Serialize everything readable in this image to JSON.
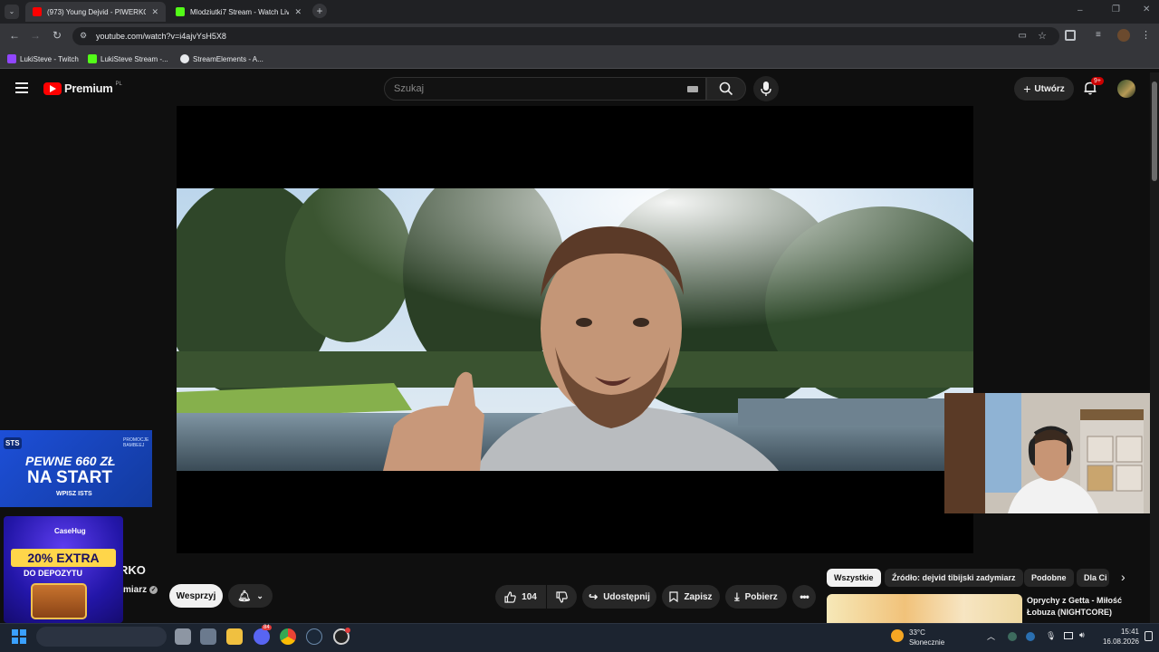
{
  "browser": {
    "tabs": [
      {
        "title": "(973) Young Dejvid - PIWERKO",
        "active": true
      },
      {
        "title": "Mlodziutki7 Stream - Watch Liv",
        "active": false
      }
    ],
    "url": "youtube.com/watch?v=i4ajvYsH5X8",
    "bookmarks": [
      "LukiSteve - Twitch",
      "LukiSteve Stream -...",
      "StreamElements - A..."
    ]
  },
  "youtube": {
    "logo_text": "Premium",
    "logo_region": "PL",
    "search_placeholder": "Szukaj",
    "create_label": "Utwórz",
    "notifications_badge": "9+"
  },
  "video": {
    "title_fragment": "RKO",
    "channel_fragment": "miarz",
    "support_label": "Wesprzyj",
    "like_count": "104",
    "share_label": "Udostępnij",
    "save_label": "Zapisz",
    "download_label": "Pobierz"
  },
  "chips": [
    "Wszystkie",
    "Źródło: dejvid tibijski zadymiarz",
    "Podobne",
    "Dla Ci"
  ],
  "recommended": {
    "title_line1": "Oprychy z Getta - Miłość",
    "title_line2": "Łobuza (NIGHTCORE)"
  },
  "overlays": {
    "ad1": {
      "line1": "PEWNE 660 ZŁ",
      "line2": "NA START",
      "line3": "WPISZ ISTS",
      "brand": "STS",
      "promo": "PROMOCJE BAMBEEJ"
    },
    "ad2": {
      "brand": "CaseHug",
      "line1": "20% EXTRA",
      "line2": "DO DEPOZYTU"
    }
  },
  "taskbar": {
    "weather_temp": "33°C",
    "weather_desc": "Słonecznie",
    "time": "15:41",
    "date": "16.08.2026",
    "discord_badge": "84"
  },
  "colors": {
    "yt_red": "#ff0000",
    "badge_red": "#cc0000"
  }
}
